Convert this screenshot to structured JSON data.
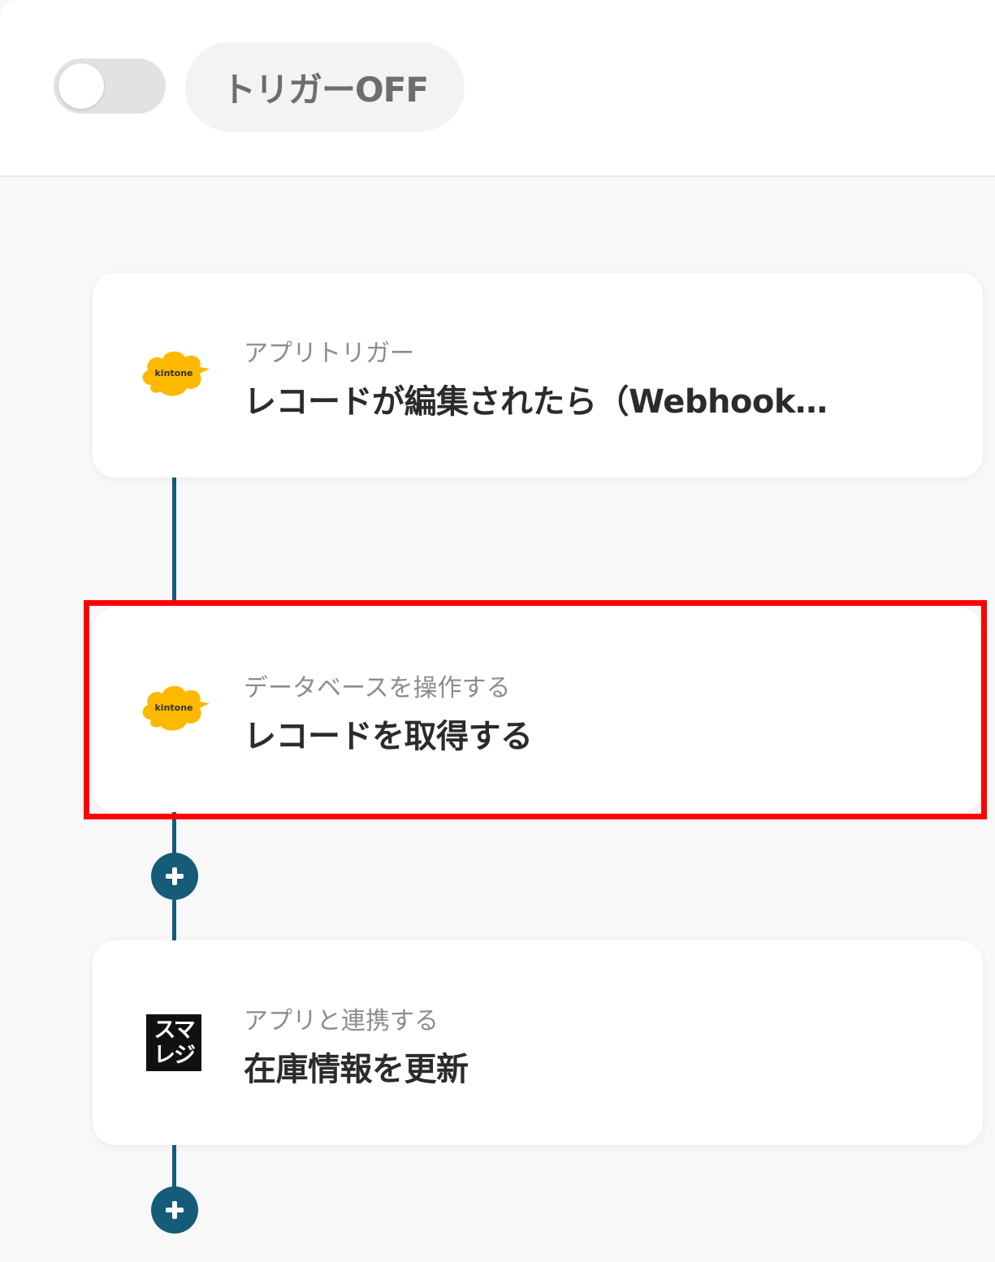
{
  "header": {
    "toggle_state": "off",
    "trigger_label": "トリガーOFF"
  },
  "steps": [
    {
      "app": "kintone",
      "icon": "kintone-logo-icon",
      "subtitle": "アプリトリガー",
      "title": "レコードが編集されたら（Webhook…"
    },
    {
      "app": "kintone",
      "icon": "kintone-logo-icon",
      "subtitle": "データベースを操作する",
      "title": "レコードを取得する",
      "highlighted": true
    },
    {
      "app": "スマレジ",
      "icon": "smaregi-logo-icon",
      "logo_text": [
        "スマ",
        "レジ"
      ],
      "subtitle": "アプリと連携する",
      "title": "在庫情報を更新"
    }
  ],
  "kintone_logo_text": "kintone",
  "colors": {
    "connector": "#145c78",
    "kintone_yellow": "#fcb900",
    "highlight": "#ff0000"
  }
}
